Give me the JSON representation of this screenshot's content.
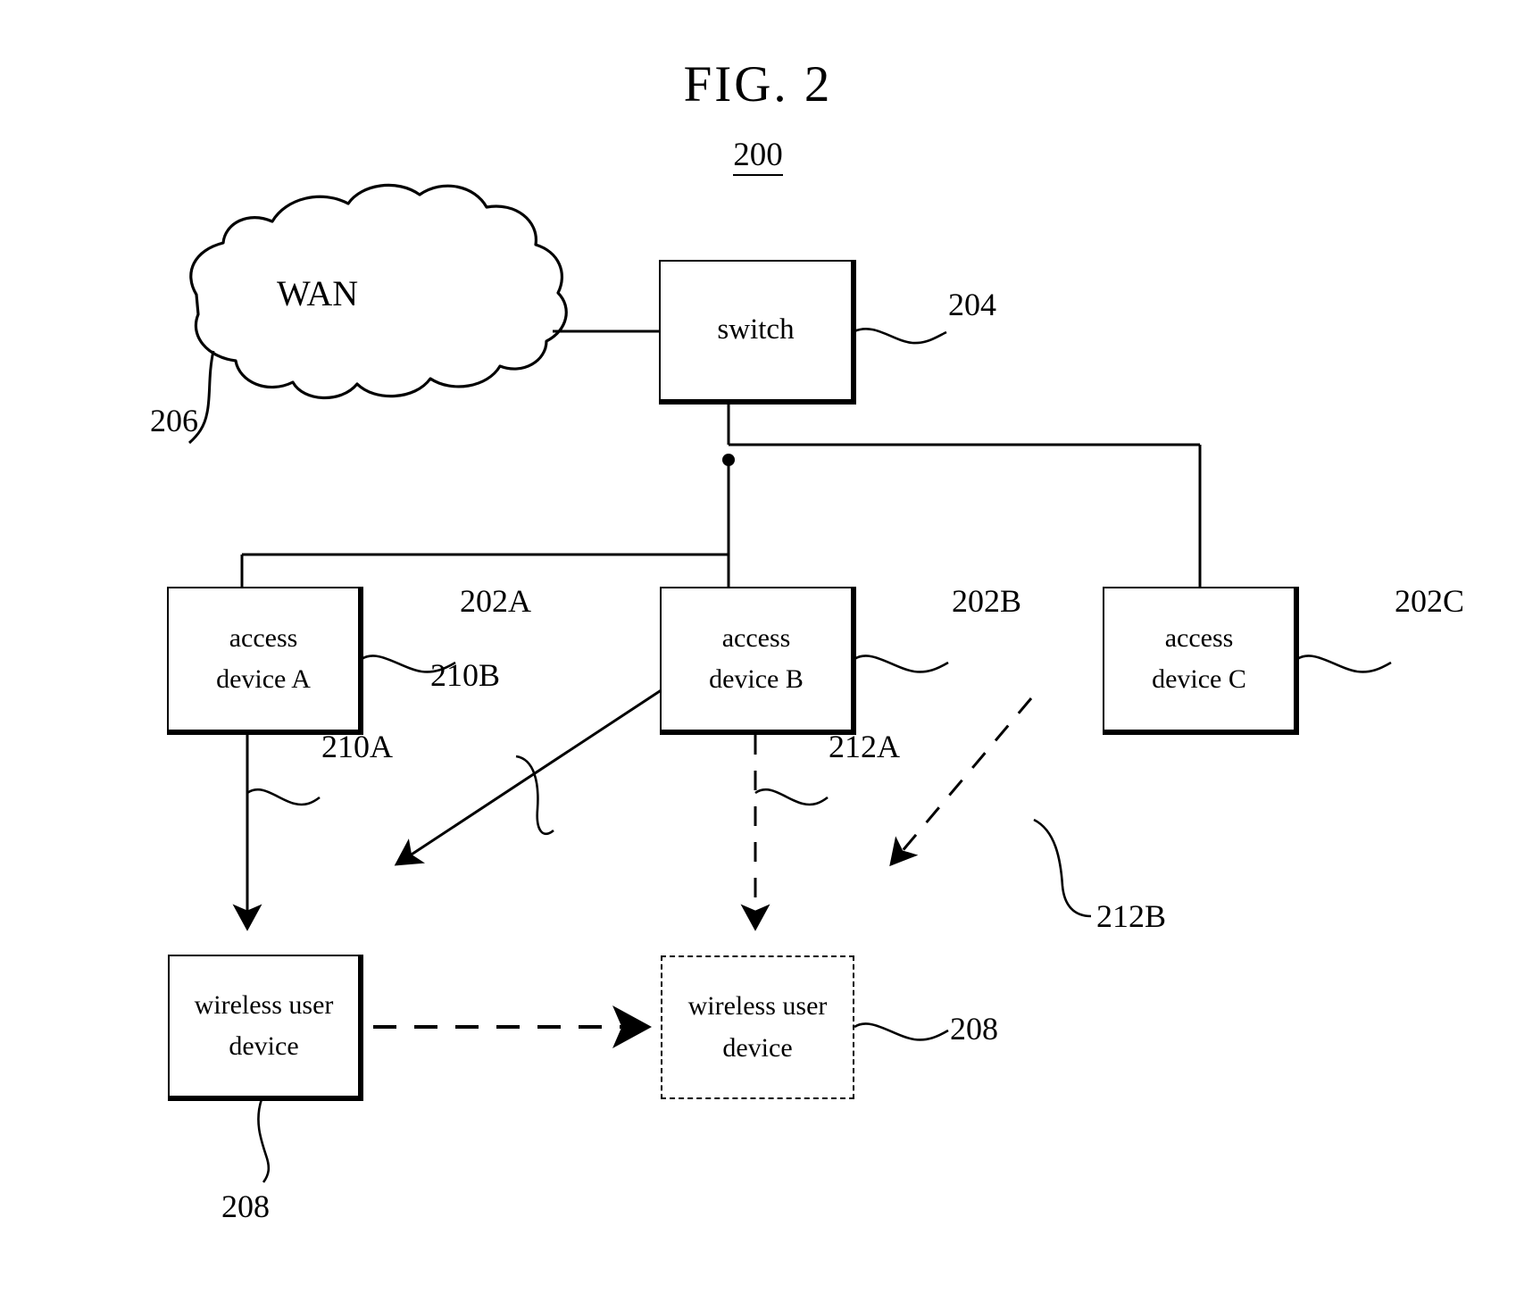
{
  "figure": {
    "title": "FIG. 2",
    "number": "200"
  },
  "nodes": {
    "wan": {
      "label": "WAN",
      "ref": "206"
    },
    "switch": {
      "label": "switch",
      "ref": "204"
    },
    "access_a": {
      "line1": "access",
      "line2": "device A",
      "ref": "202A"
    },
    "access_b": {
      "line1": "access",
      "line2": "device B",
      "ref": "202B"
    },
    "access_c": {
      "line1": "access",
      "line2": "device C",
      "ref": "202C"
    },
    "wireless_user_device_solid": {
      "line1": "wireless user",
      "line2": "device",
      "ref": "208"
    },
    "wireless_user_device_dashed": {
      "line1": "wireless user",
      "line2": "device",
      "ref": "208"
    }
  },
  "arrows": {
    "a_to_wud": {
      "ref": "210A"
    },
    "b_to_wud": {
      "ref": "210B"
    },
    "b_to_wud_dashed": {
      "ref": "212A"
    },
    "c_to_wud_dashed": {
      "ref": "212B"
    }
  },
  "colors": {
    "ink": "#000000",
    "paper": "#ffffff"
  }
}
